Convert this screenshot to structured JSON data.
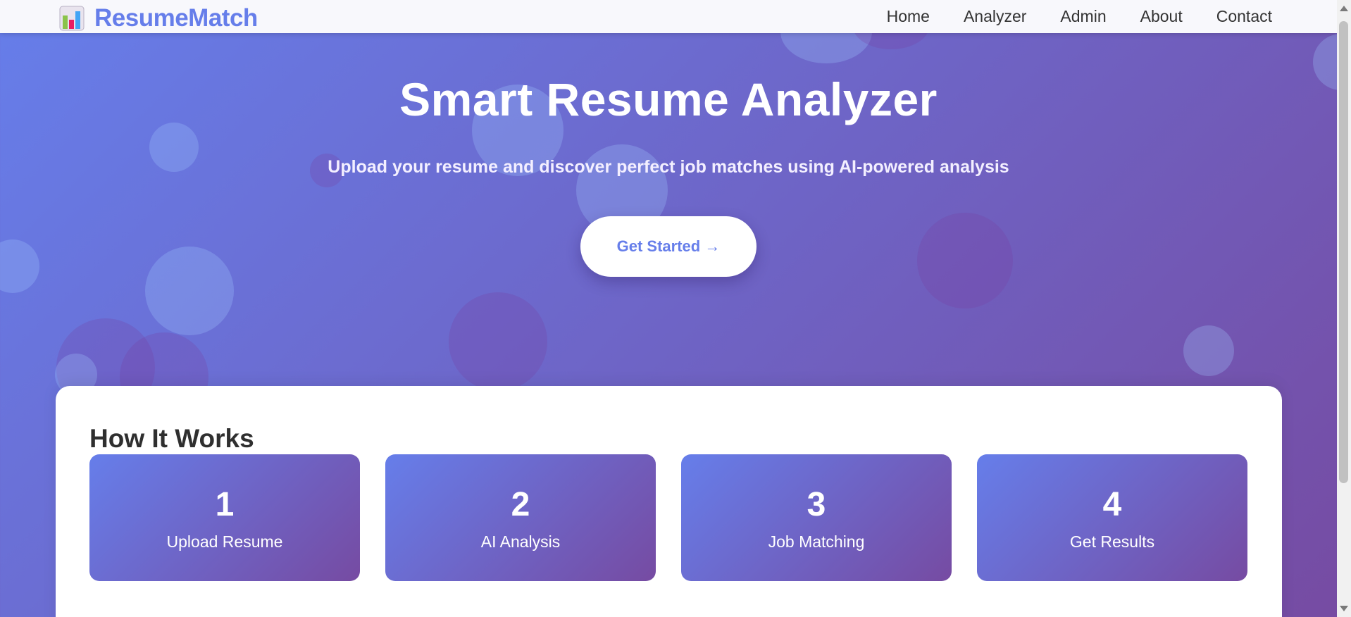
{
  "nav": {
    "brand": "ResumeMatch",
    "brand_icon": "bar-chart-icon",
    "links": [
      "Home",
      "Analyzer",
      "Admin",
      "About",
      "Contact"
    ]
  },
  "hero": {
    "title": "Smart Resume Analyzer",
    "subtitle": "Upload your resume and discover perfect job matches using AI-powered analysis",
    "cta_label": "Get Started →"
  },
  "how_it_works": {
    "title": "How It Works",
    "steps": [
      {
        "number": "1",
        "label": "Upload Resume"
      },
      {
        "number": "2",
        "label": "AI Analysis"
      },
      {
        "number": "3",
        "label": "Job Matching"
      },
      {
        "number": "4",
        "label": "Get Results"
      }
    ]
  },
  "colors": {
    "accent": "#667eea",
    "gradient_start": "#667eea",
    "gradient_end": "#764ba2"
  }
}
